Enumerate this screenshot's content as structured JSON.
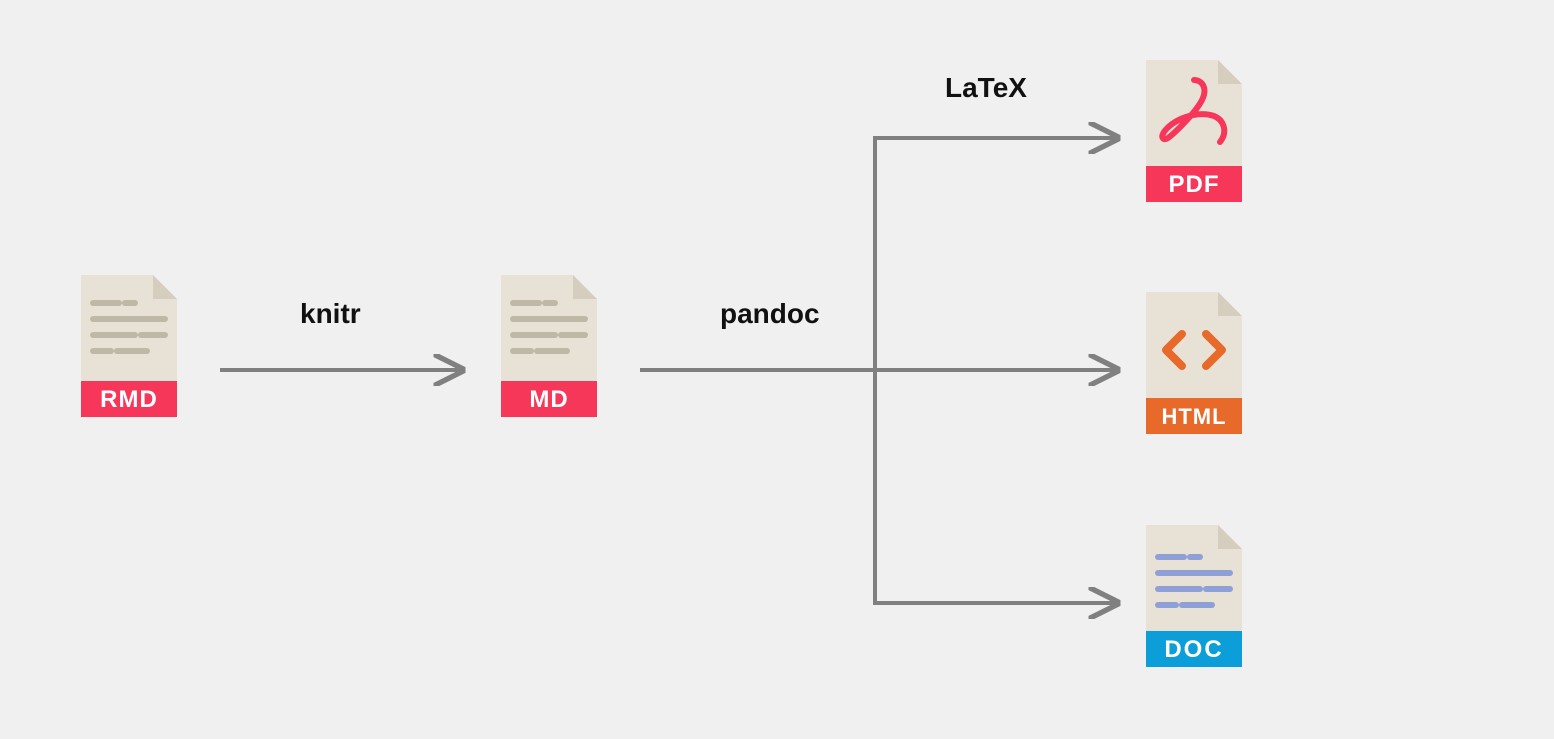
{
  "files": {
    "rmd": {
      "label": "RMD",
      "color": "#f7375a"
    },
    "md": {
      "label": "MD",
      "color": "#f7375a"
    },
    "pdf": {
      "label": "PDF",
      "color": "#f7375a"
    },
    "html": {
      "label": "HTML",
      "color": "#e76a2b"
    },
    "doc": {
      "label": "DOC",
      "color": "#0b9ed9"
    }
  },
  "arrows": {
    "knitr": "knitr",
    "pandoc": "pandoc",
    "latex": "LaTeX"
  },
  "colors": {
    "page_body": "#e8e2d6",
    "page_fold": "#d5cebf",
    "text_line": "#bfb8a7",
    "arrow": "#808080"
  }
}
